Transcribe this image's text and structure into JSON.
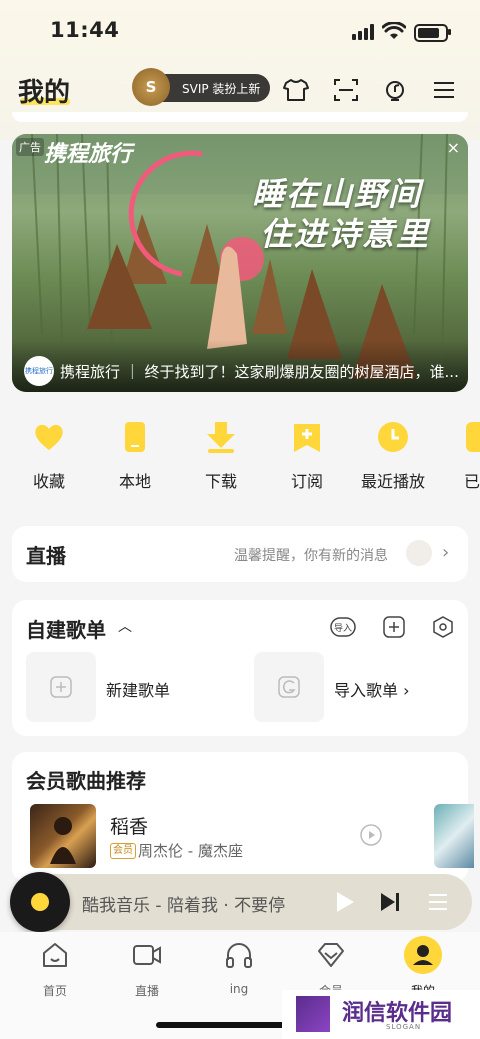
{
  "status": {
    "time": "11:44"
  },
  "header": {
    "title": "我的",
    "svip_label": "SVIP 装扮上新",
    "svip_badge": "S"
  },
  "banner": {
    "ad_tag": "广告",
    "brand": "携程旅行",
    "headline_1": "睡在山野间",
    "headline_2": "住进诗意里",
    "logo_text": "携程旅行",
    "caption": "携程旅行 ｜ 终于找到了！这家刷爆朋友圈的树屋酒店，谁..."
  },
  "quick": [
    {
      "label": "收藏",
      "icon": "heart-icon"
    },
    {
      "label": "本地",
      "icon": "phone-icon"
    },
    {
      "label": "下载",
      "icon": "download-icon"
    },
    {
      "label": "订阅",
      "icon": "subscribe-icon"
    },
    {
      "label": "最近播放",
      "icon": "clock-icon"
    },
    {
      "label": "已",
      "icon": "check-icon"
    }
  ],
  "live": {
    "title": "直播",
    "hint": "温馨提醒，你有新的消息"
  },
  "playlists": {
    "title": "自建歌单",
    "import_badge": "导入",
    "new_label": "新建歌单",
    "import_label": "导入歌单"
  },
  "vip": {
    "title": "会员歌曲推荐",
    "song": "稻香",
    "badge": "会员",
    "artist": "周杰伦 - 魔杰座"
  },
  "player": {
    "text": "酷我音乐 - 陪着我 · 不要停"
  },
  "tabs": [
    {
      "label": "首页",
      "icon": "home-icon"
    },
    {
      "label": "直播",
      "icon": "video-icon"
    },
    {
      "label": "ing",
      "icon": "headphones-icon"
    },
    {
      "label": "会员",
      "icon": "diamond-icon"
    },
    {
      "label": "我的",
      "icon": "profile-icon"
    }
  ],
  "watermark": {
    "text": "润信软件园",
    "sub": "SLOGAN"
  },
  "colors": {
    "accent": "#ffd73a",
    "svip_bg": "#3b3936"
  }
}
